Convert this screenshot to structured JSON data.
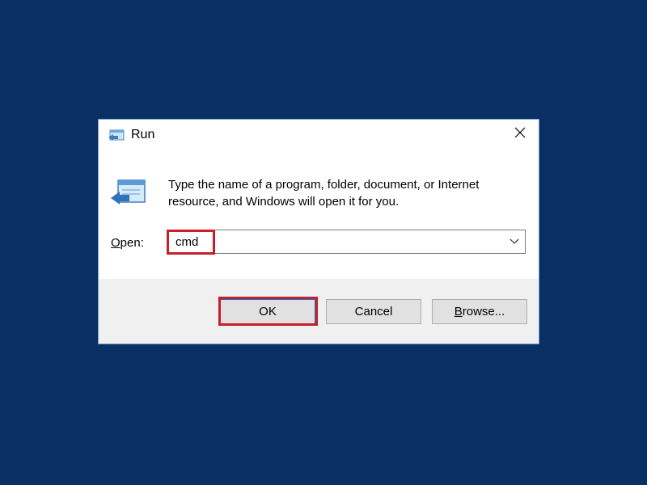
{
  "dialog": {
    "title": "Run",
    "description": "Type the name of a program, folder, document, or Internet resource, and Windows will open it for you.",
    "open_label_access_key": "O",
    "open_label_rest": "pen:",
    "input_value": "cmd",
    "buttons": {
      "ok": "OK",
      "cancel": "Cancel",
      "browse_access_key": "B",
      "browse_rest": "rowse..."
    }
  },
  "icons": {
    "title": "run-icon",
    "large": "run-icon",
    "close": "close-icon",
    "dropdown": "chevron-down-icon"
  },
  "colors": {
    "desktop": "#0a2f63",
    "highlight": "#c81e2a",
    "footer": "#f0f0f0",
    "button": "#e1e1e1",
    "focus_border": "#0078d7"
  }
}
